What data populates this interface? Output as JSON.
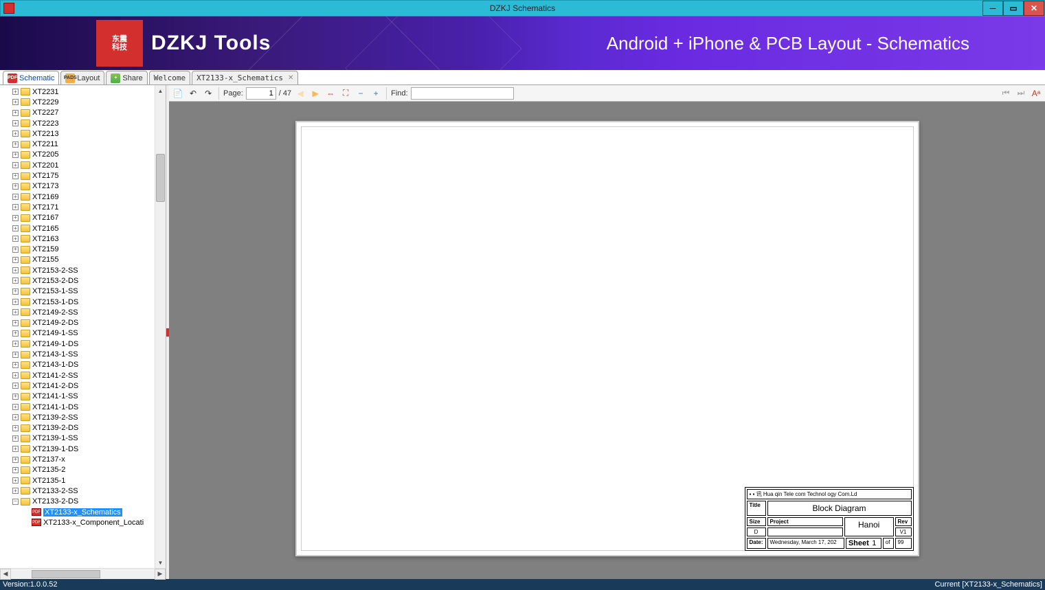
{
  "window": {
    "title": "DZKJ Schematics"
  },
  "banner": {
    "logo_cn_top": "东震",
    "logo_cn_bot": "科技",
    "brand": "DZKJ Tools",
    "tagline": "Android + iPhone & PCB Layout - Schematics"
  },
  "mode_tabs": [
    {
      "id": "schematic",
      "label": "Schematic",
      "icon": "PDF"
    },
    {
      "id": "layout",
      "label": "Layout",
      "icon": "PADS"
    },
    {
      "id": "share",
      "label": "Share",
      "icon": "+"
    }
  ],
  "doc_tabs": [
    {
      "label": "Welcome",
      "closable": false
    },
    {
      "label": "XT2133-x_Schematics",
      "closable": true
    }
  ],
  "tree": {
    "folders": [
      "XT2231",
      "XT2229",
      "XT2227",
      "XT2223",
      "XT2213",
      "XT2211",
      "XT2205",
      "XT2201",
      "XT2175",
      "XT2173",
      "XT2169",
      "XT2171",
      "XT2167",
      "XT2165",
      "XT2163",
      "XT2159",
      "XT2155",
      "XT2153-2-SS",
      "XT2153-2-DS",
      "XT2153-1-SS",
      "XT2153-1-DS",
      "XT2149-2-SS",
      "XT2149-2-DS",
      "XT2149-1-SS",
      "XT2149-1-DS",
      "XT2143-1-SS",
      "XT2143-1-DS",
      "XT2141-2-SS",
      "XT2141-2-DS",
      "XT2141-1-SS",
      "XT2141-1-DS",
      "XT2139-2-SS",
      "XT2139-2-DS",
      "XT2139-1-SS",
      "XT2139-1-DS",
      "XT2137-x",
      "XT2135-2",
      "XT2135-1",
      "XT2133-2-SS"
    ],
    "open_folder": "XT2133-2-DS",
    "files": [
      {
        "label": "XT2133-x_Schematics",
        "selected": true
      },
      {
        "label": "XT2133-x_Component_Locati",
        "selected": false
      }
    ]
  },
  "toolbar": {
    "page_label": "Page:",
    "page_current": "1",
    "page_total": "/ 47",
    "find_label": "Find:"
  },
  "title_block": {
    "company": "▪ ▪ 讯 Hua qin Tele com Technol ogy Com.Ld",
    "title_lbl": "Title",
    "title_val": "Block Diagram",
    "size_lbl": "Size",
    "size_val": "D",
    "project_lbl": "Project",
    "project_val": "Hanoi",
    "rev_lbl": "Rev",
    "rev_val": "V1",
    "date_lbl": "Date:",
    "date_val": "Wednesday, March 17, 202",
    "sheet_lbl": "Sheet",
    "sheet_num": "1",
    "of_lbl": "of",
    "sheet_total": "99"
  },
  "status": {
    "version": "Version:1.0.0.52",
    "current": "Current [XT2133-x_Schematics]"
  }
}
